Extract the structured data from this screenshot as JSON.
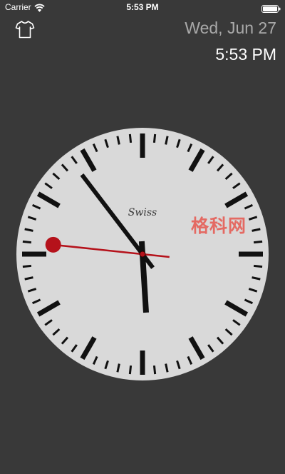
{
  "status_bar": {
    "carrier": "Carrier",
    "time": "5:53 PM",
    "icons": [
      "wifi-icon",
      "battery-icon"
    ]
  },
  "header": {
    "theme_button_icon": "tshirt-icon",
    "date": "Wed, Jun 27",
    "time": "5:53 PM"
  },
  "clock": {
    "brand": "Swiss",
    "time": {
      "hour": 5,
      "minute": 53,
      "second": 46
    },
    "colors": {
      "face": "#d9d9d9",
      "ticks": "#111111",
      "hands": "#111111",
      "second_hand": "#b5121b",
      "background": "#393939"
    }
  },
  "watermark": "格科网"
}
